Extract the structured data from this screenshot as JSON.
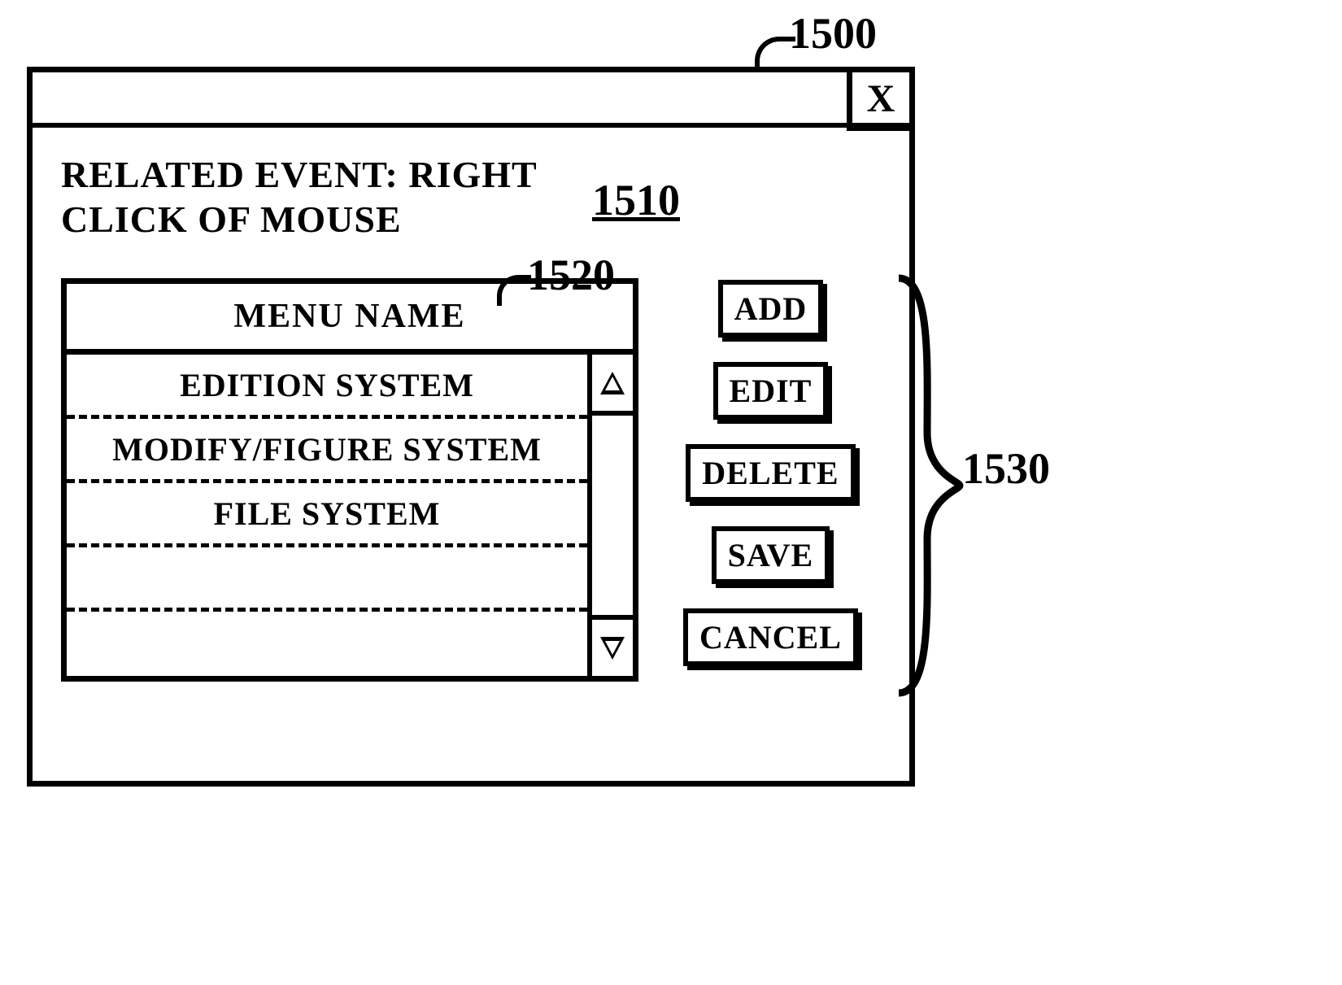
{
  "callouts": {
    "ref_window": "1500",
    "ref_event": "1510",
    "ref_list": "1520",
    "ref_buttons": "1530"
  },
  "titlebar": {
    "close_label": "X"
  },
  "event": {
    "label": "RELATED EVENT: RIGHT CLICK OF MOUSE"
  },
  "listbox": {
    "header": "MENU NAME",
    "items": [
      "EDITION SYSTEM",
      "MODIFY/FIGURE SYSTEM",
      "FILE SYSTEM",
      "",
      ""
    ]
  },
  "buttons": {
    "add": "ADD",
    "edit": "EDIT",
    "delete": "DELETE",
    "save": "SAVE",
    "cancel": "CANCEL"
  }
}
